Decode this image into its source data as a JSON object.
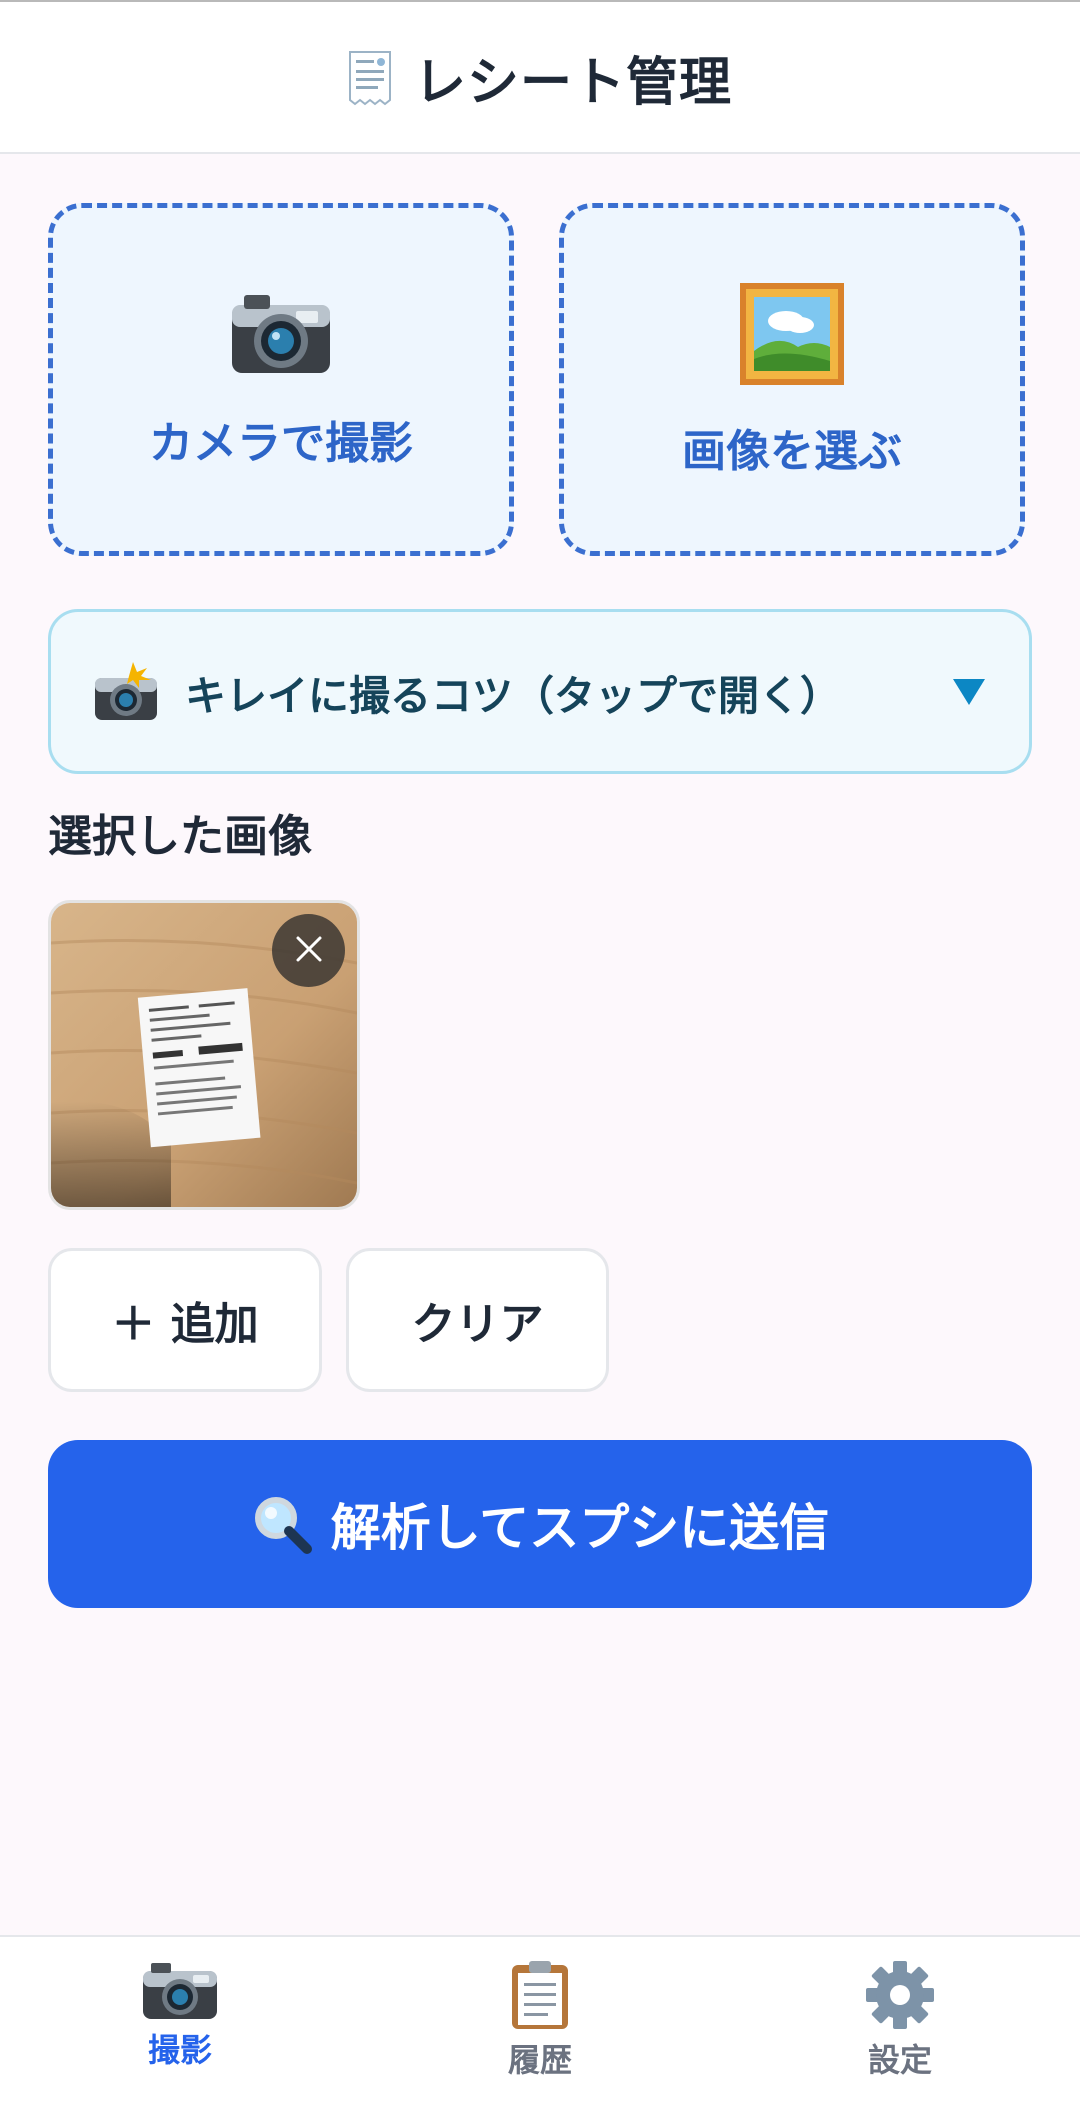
{
  "header": {
    "title": "レシート管理",
    "icon": "receipt-icon"
  },
  "actions": {
    "camera_label": "カメラで撮影",
    "camera_icon": "camera-icon",
    "gallery_label": "画像を選ぶ",
    "gallery_icon": "framed-picture-icon"
  },
  "tips": {
    "label": "キレイに撮るコツ（タップで開く）",
    "icon": "camera-flash-icon",
    "toggle_icon": "triangle-down-icon"
  },
  "selected": {
    "title": "選択した画像",
    "images": [
      {
        "receipt_text": "¥1,200円"
      }
    ]
  },
  "buttons": {
    "add_label": "＋ 追加",
    "clear_label": "クリア",
    "submit_label": "解析してスプシに送信",
    "submit_icon": "magnifier-icon"
  },
  "nav": {
    "items": [
      {
        "label": "撮影",
        "icon": "camera-icon",
        "active": true
      },
      {
        "label": "履歴",
        "icon": "clipboard-icon",
        "active": false
      },
      {
        "label": "設定",
        "icon": "gear-icon",
        "active": false
      }
    ]
  },
  "colors": {
    "accent": "#2563eb",
    "card_border": "#3b6fd0",
    "card_bg": "#eef6fe",
    "tips_border": "#a8def0"
  }
}
